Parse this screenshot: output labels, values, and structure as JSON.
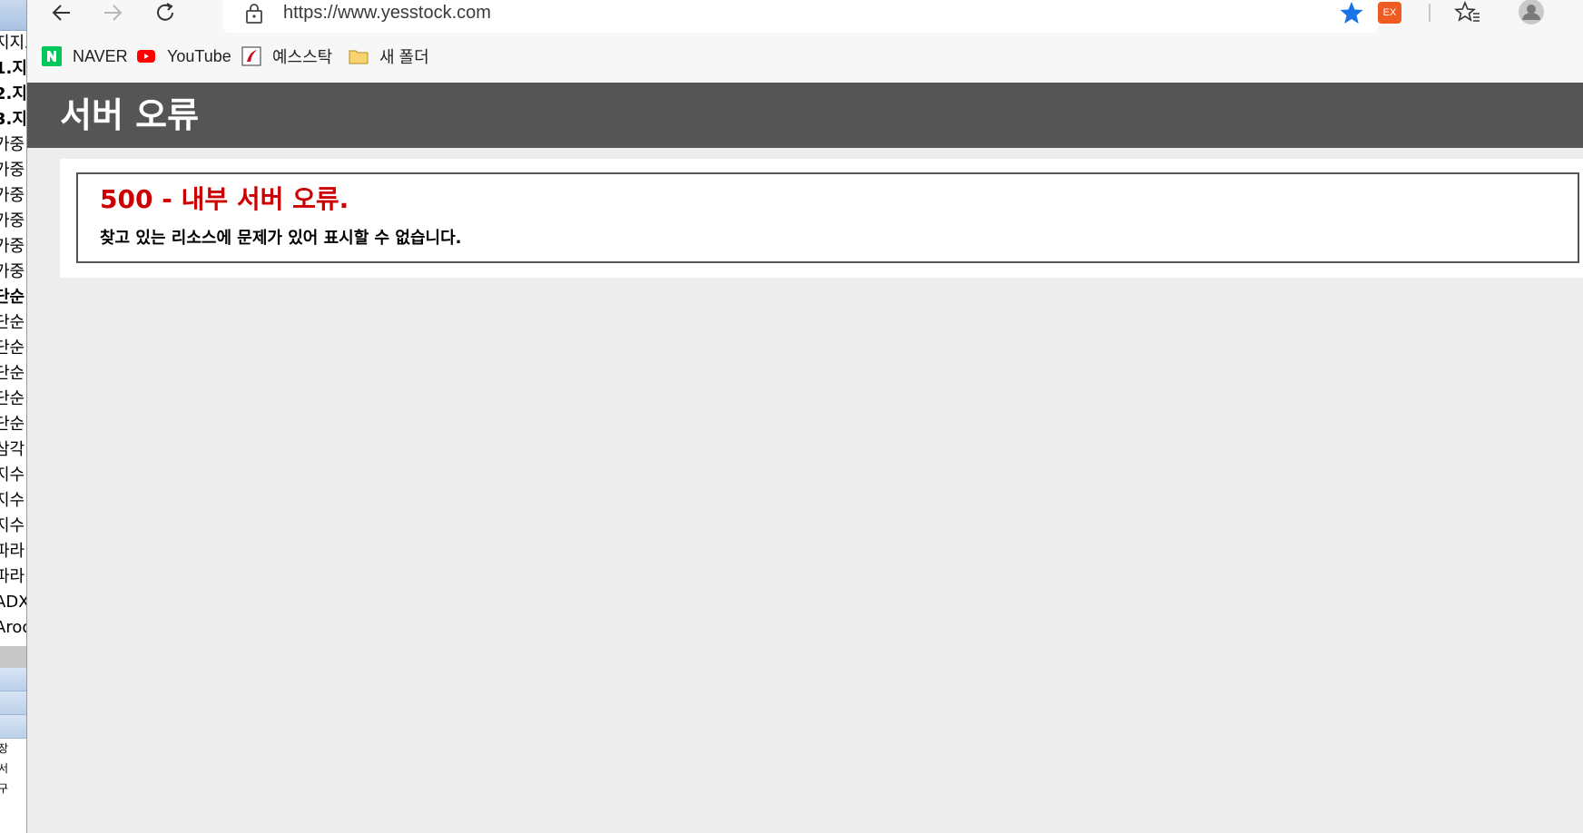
{
  "background_window": {
    "rows": [
      {
        "text": "지지표",
        "bold": false
      },
      {
        "text": "1.지",
        "bold": true
      },
      {
        "text": "2.지",
        "bold": true
      },
      {
        "text": "3.지",
        "bold": true
      },
      {
        "text": "가중",
        "bold": false
      },
      {
        "text": "가중",
        "bold": false
      },
      {
        "text": "가중",
        "bold": false
      },
      {
        "text": "가중",
        "bold": false
      },
      {
        "text": "가중",
        "bold": false
      },
      {
        "text": "가중",
        "bold": false
      },
      {
        "text": "단순",
        "bold": true
      },
      {
        "text": "단순",
        "bold": false
      },
      {
        "text": "단순",
        "bold": false
      },
      {
        "text": "단순",
        "bold": false
      },
      {
        "text": "단순",
        "bold": false
      },
      {
        "text": "단순",
        "bold": false
      },
      {
        "text": "삼각",
        "bold": false
      },
      {
        "text": "지수",
        "bold": false
      },
      {
        "text": "지수",
        "bold": false
      },
      {
        "text": "지수",
        "bold": false
      },
      {
        "text": "파라",
        "bold": false
      },
      {
        "text": "파라",
        "bold": false
      },
      {
        "text": "ADX",
        "bold": false
      },
      {
        "text": "Aroo",
        "bold": false
      }
    ],
    "small_rows": [
      "장",
      "서",
      "구"
    ]
  },
  "browser": {
    "url": "https://www.yesstock.com",
    "extension_label": "EX",
    "bookmarks": [
      {
        "label": "NAVER",
        "icon": "naver-icon"
      },
      {
        "label": "YouTube",
        "icon": "youtube-icon"
      },
      {
        "label": "예스스탁",
        "icon": "yesstock-icon"
      },
      {
        "label": "새 폴더",
        "icon": "folder-icon"
      }
    ]
  },
  "page": {
    "header_title": "서버 오류",
    "error_title": "500 - 내부 서버 오류.",
    "error_message": "찾고 있는 리소스에 문제가 있어 표시할 수 없습니다."
  },
  "colors": {
    "header_bg": "#555555",
    "error_red": "#cc0000",
    "star_blue": "#1a73e8",
    "extension_orange": "#f05b22"
  }
}
